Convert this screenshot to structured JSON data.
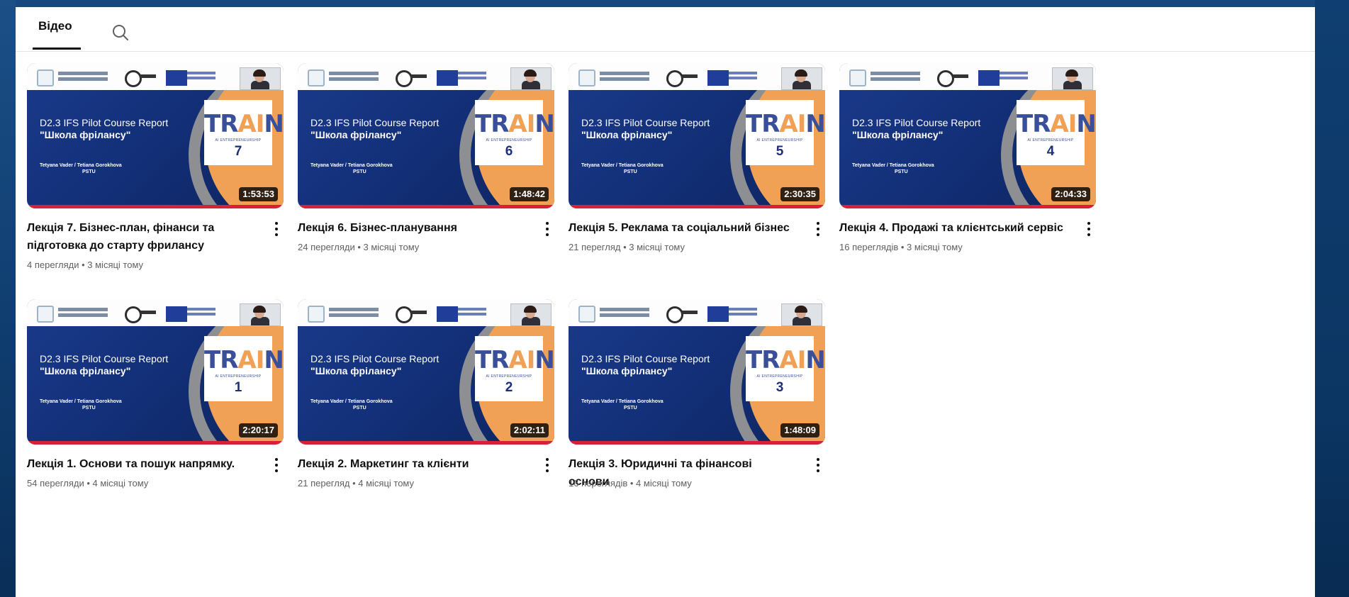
{
  "tabs": {
    "video_label": "Відео"
  },
  "icons": {
    "search": "search-icon",
    "more": "more-vert-icon"
  },
  "colors": {
    "accent_red": "#d8203a",
    "thumb_blue": "#13307a",
    "thumb_orange": "#f0a156"
  },
  "thumbnail_common": {
    "title_line1": "D2.3 IFS Pilot Course Report",
    "title_line2": "\"Школа фрілансу\"",
    "authors": "Tetyana Vader / Tetiana Gorokhova",
    "org": "PSTU",
    "train_word_a": "TR",
    "train_word_ai": "AI",
    "train_word_b": "N",
    "train_sub": "AI ENTREPRENEURSHIP"
  },
  "videos": [
    {
      "title": "Лекція 7. Бізнес-план, фінанси та підготовка до старту фрилансу",
      "meta": "4 перегляди • 3 місяці тому",
      "duration": "1:53:53",
      "number": "7"
    },
    {
      "title": "Лекція 6. Бізнес-планування",
      "meta": "24 перегляди • 3 місяці тому",
      "duration": "1:48:42",
      "number": "6"
    },
    {
      "title": "Лекція 5. Реклама та соціальний бізнес",
      "meta": "21 перегляд • 3 місяці тому",
      "duration": "2:30:35",
      "number": "5"
    },
    {
      "title": "Лекція 4. Продажі та клієнтський сервіс",
      "meta": "16 переглядів • 3 місяці тому",
      "duration": "2:04:33",
      "number": "4"
    },
    {
      "title": "Лекція 1. Основи та пошук напрямку.",
      "meta": "54 перегляди • 4 місяці тому",
      "duration": "2:20:17",
      "number": "1"
    },
    {
      "title": "Лекція 2. Маркетинг та клієнти",
      "meta": "21 перегляд • 4 місяці тому",
      "duration": "2:02:11",
      "number": "2"
    },
    {
      "title": "Лекція 3. Юридичні та фінансові основи",
      "meta": "16 переглядів • 4 місяці тому",
      "duration": "1:48:09",
      "number": "3"
    }
  ]
}
